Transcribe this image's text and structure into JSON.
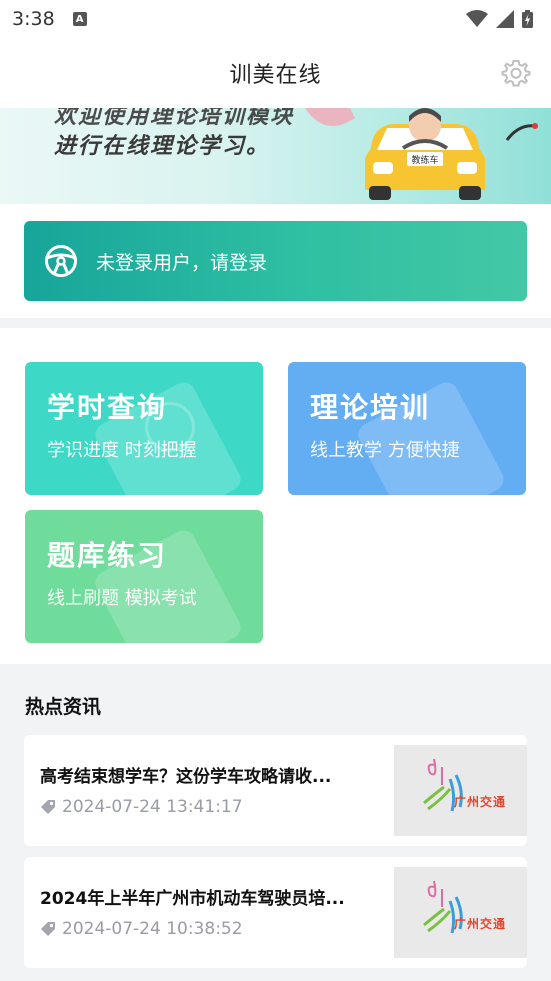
{
  "status_bar": {
    "time": "3:38",
    "notification_letter": "A"
  },
  "header": {
    "title": "训美在线"
  },
  "banner": {
    "line1": "欢迎使用理论培训模块",
    "line2": "进行在线理论学习。",
    "car_plate": "教练车"
  },
  "login": {
    "text": "未登录用户，请登录"
  },
  "tiles": [
    {
      "title": "学时查询",
      "subtitle": "学识进度 时刻把握"
    },
    {
      "title": "理论培训",
      "subtitle": "线上教学 方便快捷"
    },
    {
      "title": "题库练习",
      "subtitle": "线上刷题 模拟考试"
    }
  ],
  "news": {
    "heading": "热点资讯",
    "items": [
      {
        "title": "高考结束想学车？这份学车攻略请收...",
        "time": "2024-07-24 13:41:17",
        "thumb_text": "广州交通"
      },
      {
        "title": "2024年上半年广州市机动车驾驶员培...",
        "time": "2024-07-24 10:38:52",
        "thumb_text": "广州交通"
      }
    ]
  },
  "colors": {
    "accent_teal": "#17a59a",
    "tile_study": "#3dd9c6",
    "tile_theory": "#63adf2",
    "tile_bank": "#6fdc9b",
    "car_yellow": "#f7c531"
  },
  "icons": {
    "status": [
      "wifi-icon",
      "signal-icon",
      "battery-icon"
    ],
    "header": "gear-icon",
    "login": "steering-wheel-icon",
    "news": "tag-icon"
  }
}
